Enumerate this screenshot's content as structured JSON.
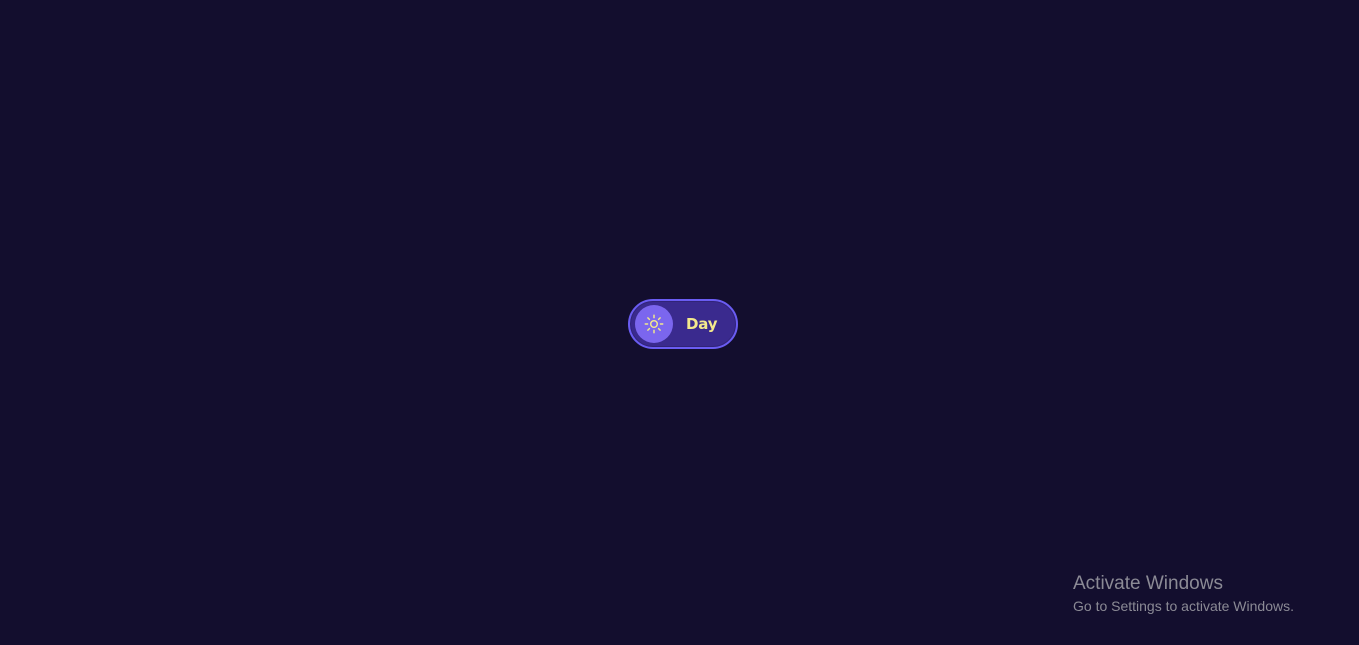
{
  "toggle": {
    "label": "Day",
    "icon": "sun-icon",
    "state": "day"
  },
  "watermark": {
    "title": "Activate Windows",
    "subtitle": "Go to Settings to activate Windows."
  },
  "colors": {
    "background": "#130e2e",
    "toggle_track": "#3a2a8e",
    "toggle_border": "#6a5cf2",
    "knob": "#7b66ee",
    "label": "#f3e98c",
    "watermark_text": "#8b8a95"
  }
}
